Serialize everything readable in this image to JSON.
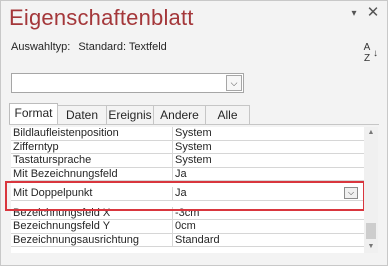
{
  "window": {
    "title": "Eigenschaftenblatt",
    "dropdown_glyph": "▾",
    "close_glyph": "✕"
  },
  "selection_type": {
    "label": "Auswahltyp:",
    "value": "Standard: Textfeld"
  },
  "sort_icon": {
    "top": "A",
    "bottom": "Z",
    "arrow": "↓"
  },
  "object_selector": {
    "value": "",
    "button_glyph": "⌵"
  },
  "tabs": [
    {
      "label": "Format",
      "active": true
    },
    {
      "label": "Daten",
      "active": false
    },
    {
      "label": "Ereignis",
      "active": false
    },
    {
      "label": "Andere",
      "active": false
    },
    {
      "label": "Alle",
      "active": false
    }
  ],
  "properties": [
    {
      "name": "Bildlaufleistenposition",
      "value": "System"
    },
    {
      "name": "Zifferntyp",
      "value": "System"
    },
    {
      "name": "Tastatursprache",
      "value": "System"
    },
    {
      "name": "Mit Bezeichnungsfeld",
      "value": "Ja"
    },
    {
      "name": "Mit Doppelpunkt",
      "value": "Ja",
      "dropdown": "⌵"
    },
    {
      "name": "Bezeichnungsfeld X",
      "value": "-3cm"
    },
    {
      "name": "Bezeichnungsfeld Y",
      "value": "0cm"
    },
    {
      "name": "Bezeichnungsausrichtung",
      "value": "Standard"
    }
  ],
  "colors": {
    "title": "#a4373a",
    "highlight_border": "#d9363e"
  },
  "scrollbar": {
    "up_glyph": "▲",
    "down_glyph": "▼"
  }
}
